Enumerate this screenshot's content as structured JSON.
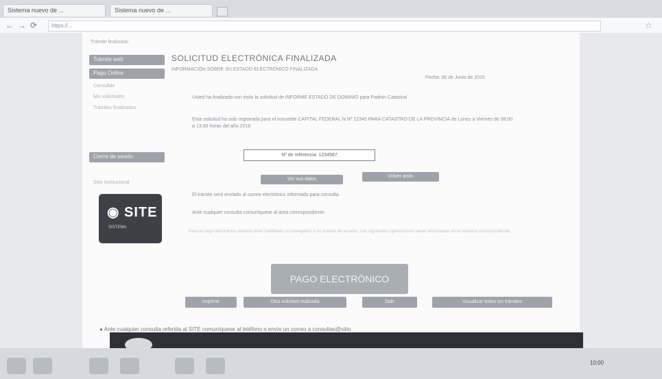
{
  "browser": {
    "tabs": [
      "Sistema nuevo de ...",
      "Sistema nuevo de ..."
    ],
    "url": "https://..."
  },
  "breadcrumb": "Trámite finalizado",
  "sidebar": {
    "items": [
      "Trámite web",
      "Pago Online"
    ],
    "links": [
      "Consultas",
      "Mis solicitudes",
      "Trámites finalizados"
    ],
    "bottom_button": "Cierre de sesión",
    "section_label": "Sitio Institucional"
  },
  "logo": {
    "text": "SITE",
    "sub": "SISTEMA"
  },
  "main": {
    "title": "SOLICITUD ELECTRÓNICA FINALIZADA",
    "subtitle": "INFORMACIÓN SOBRE SU ESTADO ELECTRÓNICO FINALIZADA",
    "date": "Fecha: 08 de Junio de 2016",
    "para1": "Usted ha finalizado con éxito la solicitud de INFORME ESTADO DE DOMINIO para Padrón Catastral",
    "para2": "Esta solicitud ha sido registrada para el inmueble CAPITAL FEDERAL N.Nº 12345 PARA CATASTRO DE LA PROVINCIA de Lunes a Viernes de 08:00 a 13:00 horas del año 2016",
    "reference": "Nº de referencia: 1234567",
    "btn_view_data": "Ver sus datos",
    "btn_view_tickets": "Volver atrás",
    "para3": "El trámite será enviado al correo electrónico informado para consulta.",
    "para4": "Ante cualquier consulta comuníquese al área correspondiente.",
    "note": "Para el pago electrónico deberá tener habilitado su navegador y su cuenta de acceso. Las siguientes operaciones serán efectuadas en el sistema correspondiente.",
    "pay_button": "PAGO ELECTRÓNICO",
    "btn_print": "Imprimir",
    "btn_new": "Otra solicitud realizada",
    "btn_back": "Salir",
    "btn_send": "Visualizar todos los trámites"
  },
  "footer": "Ante cualquier consulta referida al SITE comuníquese al teléfono o envíe un correo a consultas@sitio",
  "taskbar": {
    "clock": "10:00"
  }
}
